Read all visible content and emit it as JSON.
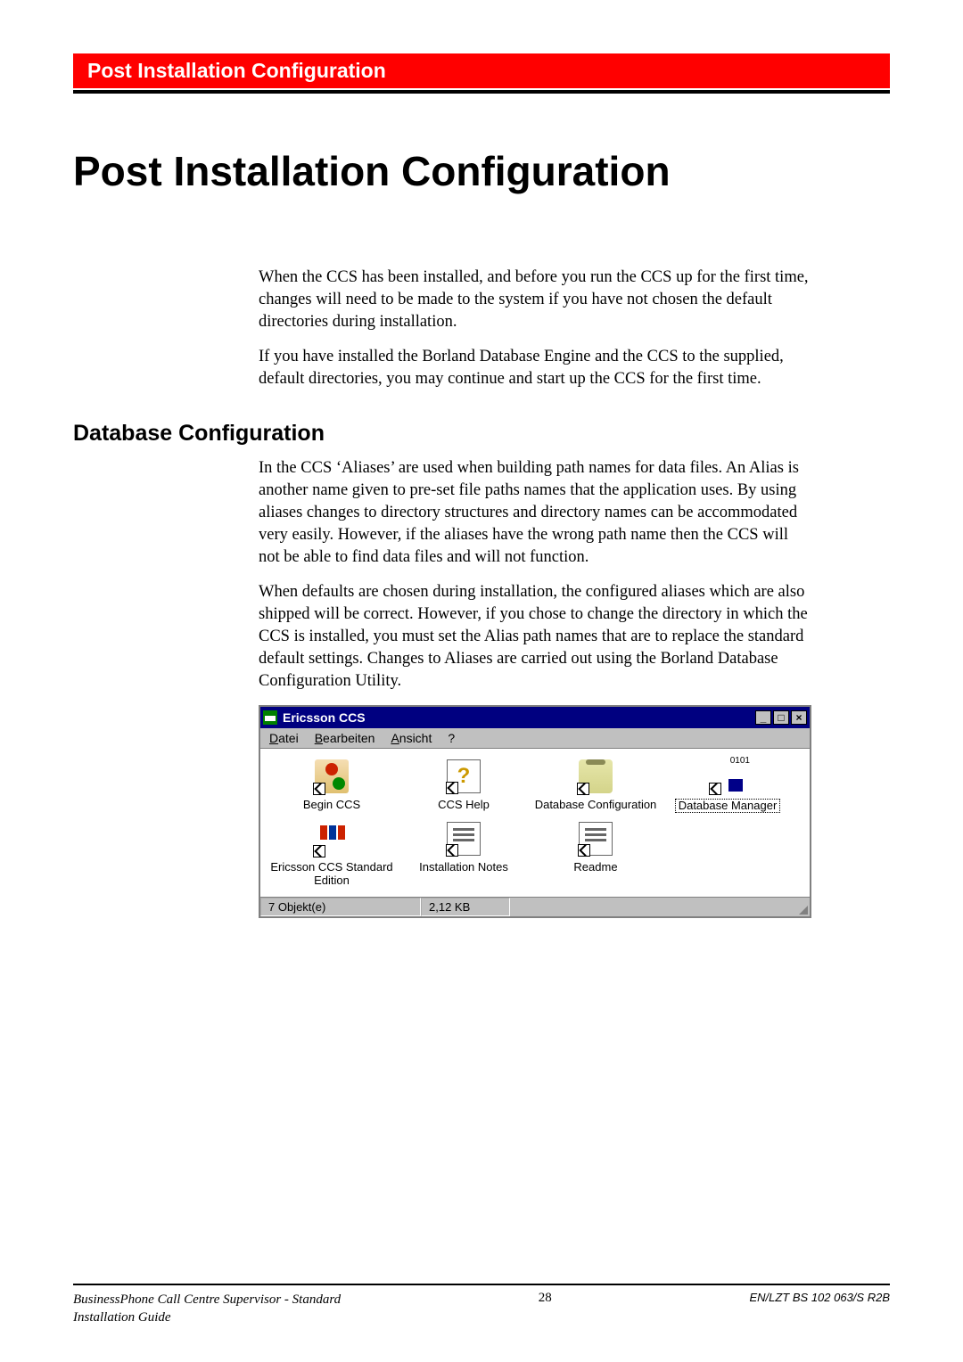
{
  "banner": "Post Installation Configuration",
  "title": "Post Installation Configuration",
  "para1": "When the CCS has been installed, and before you run the CCS up for the first time, changes will need to be made to the system if you have not chosen the default directories during installation.",
  "para2": "If you have installed the Borland Database Engine and the CCS to the supplied, default directories, you may continue and start up the CCS for the first time.",
  "section": "Database Configuration",
  "para3": "In the CCS ‘Aliases’ are used when building path names for data files. An Alias is another name given to pre-set file paths names that the application uses. By using aliases changes to directory structures and directory names can be accommodated very easily. However, if the aliases have the wrong path name then the CCS will not be able to find data files and will not function.",
  "para4": "When defaults are chosen during installation, the configured aliases which are also shipped will be correct. However, if you chose to change the directory in which the CCS is installed, you must set the Alias path names that are to replace the standard default settings. Changes to Aliases are carried out using the Borland Database Configuration Utility.",
  "window": {
    "title": "Ericsson CCS",
    "menu": {
      "datei": "Datei",
      "bearbeiten": "Bearbeiten",
      "ansicht": "Ansicht",
      "help": "?"
    },
    "menu_ul": {
      "datei": "D",
      "bearbeiten": "B",
      "ansicht": "A",
      "help": "?"
    },
    "icons": {
      "begin": "Begin CCS",
      "help": "CCS Help",
      "dbconf": "Database Configuration",
      "dbmgr": "Database Manager",
      "ericsson": "Ericsson CCS Standard Edition",
      "notes": "Installation Notes",
      "readme": "Readme"
    },
    "status": {
      "objects": "7 Objekt(e)",
      "size": "2,12 KB"
    },
    "buttons": {
      "min": "_",
      "max": "□",
      "close": "×"
    }
  },
  "footer": {
    "left1": "BusinessPhone Call Centre Supervisor - Standard",
    "left2": "Installation Guide",
    "page": "28",
    "right": "EN/LZT BS 102 063/S R2B"
  }
}
